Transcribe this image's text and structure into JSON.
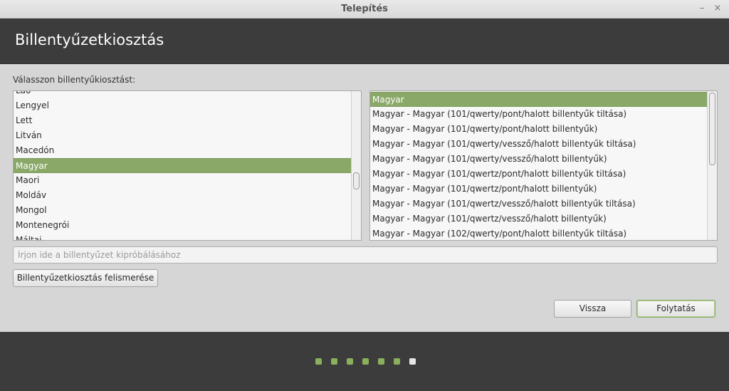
{
  "window": {
    "title": "Telepítés",
    "minimize_glyph": "–",
    "close_glyph": "×"
  },
  "header": {
    "title": "Billentyűzetkiosztás"
  },
  "prompt": "Válasszon billentyűkiosztást:",
  "layouts": {
    "items": [
      "Lao",
      "Lengyel",
      "Lett",
      "Litván",
      "Macedón",
      "Magyar",
      "Maori",
      "Moldáv",
      "Mongol",
      "Montenegrói",
      "Máltai"
    ],
    "selected": "Magyar"
  },
  "variants": {
    "items": [
      "Magyar",
      "Magyar - Magyar (101/qwerty/pont/halott billentyűk tiltása)",
      "Magyar - Magyar (101/qwerty/pont/halott billentyűk)",
      "Magyar - Magyar (101/qwerty/vessző/halott billentyűk tiltása)",
      "Magyar - Magyar (101/qwerty/vessző/halott billentyűk)",
      "Magyar - Magyar (101/qwertz/pont/halott billentyűk tiltása)",
      "Magyar - Magyar (101/qwertz/pont/halott billentyűk)",
      "Magyar - Magyar (101/qwertz/vessző/halott billentyűk tiltása)",
      "Magyar - Magyar (101/qwertz/vessző/halott billentyűk)",
      "Magyar - Magyar (102/qwerty/pont/halott billentyűk tiltása)"
    ],
    "selected": "Magyar"
  },
  "test_input": {
    "placeholder": "Írjon ide a billentyűzet kipróbálásához",
    "value": ""
  },
  "detect_button": "Billentyűzetkiosztás felismerése",
  "back_button": "Vissza",
  "continue_button": "Folytatás",
  "progress": {
    "total_steps": 7,
    "current_step": 7
  },
  "colors": {
    "accent": "#8aa868",
    "header_bg": "#3c3c3c",
    "dot_done": "#8ab05c",
    "dot_current": "#e6e6e6"
  }
}
